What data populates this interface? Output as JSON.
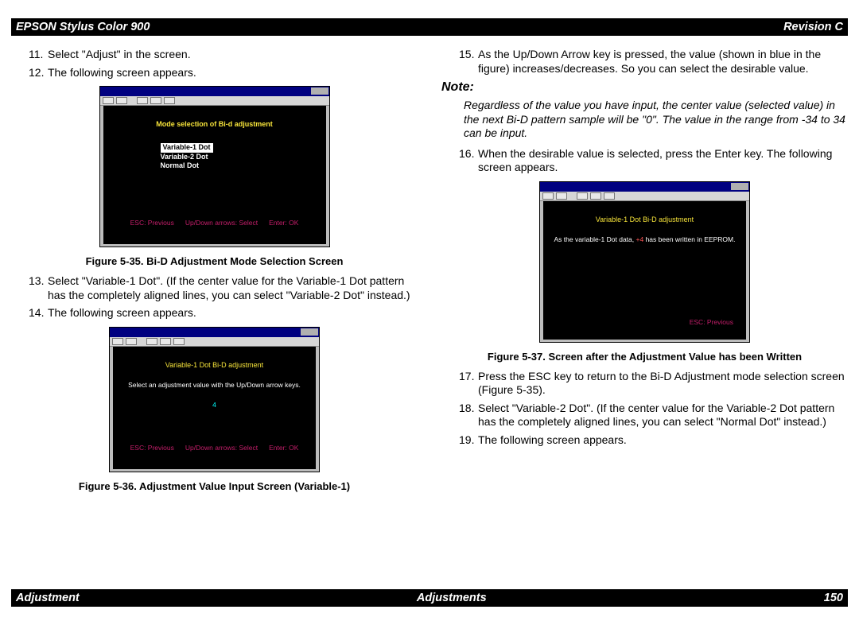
{
  "header": {
    "left": "EPSON Stylus Color 900",
    "right": "Revision C"
  },
  "footer": {
    "left": "Adjustment",
    "center": "Adjustments",
    "right": "150"
  },
  "left": {
    "step11": {
      "num": "11.",
      "text": "Select \"Adjust\" in the screen."
    },
    "step12": {
      "num": "12.",
      "text": "The following screen appears."
    },
    "fig35": {
      "caption": "Figure 5-35.  Bi-D Adjustment Mode Selection Screen",
      "title": "Mode selection of Bi-d adjustment",
      "opt1": "Variable-1 Dot",
      "opt2": "Variable-2 Dot",
      "opt3": "Normal Dot",
      "esc": "ESC: Previous",
      "arrows": "Up/Down arrows: Select",
      "enter": "Enter: OK"
    },
    "step13": {
      "num": "13.",
      "text": "Select \"Variable-1 Dot\". (If the center value for the Variable-1 Dot pattern has the completely aligned lines, you can select \"Variable-2 Dot\" instead.)"
    },
    "step14": {
      "num": "14.",
      "text": "The following screen appears."
    },
    "fig36": {
      "caption": "Figure 5-36.  Adjustment Value Input Screen (Variable-1)",
      "title": "Variable-1 Dot Bi-D adjustment",
      "instr": "Select an adjustment value with the Up/Down arrow keys.",
      "value": "4",
      "esc": "ESC: Previous",
      "arrows": "Up/Down arrows: Select",
      "enter": "Enter: OK"
    }
  },
  "right": {
    "step15": {
      "num": "15.",
      "text": "As the Up/Down Arrow key is pressed, the value (shown in blue in the figure) increases/decreases. So you can select the desirable value."
    },
    "note": {
      "label": "Note:",
      "body": "Regardless of the value you have input, the center value (selected value) in the next Bi-D pattern sample will be \"0\". The value in the range from -34 to 34 can be input."
    },
    "step16": {
      "num": "16.",
      "text": "When the desirable value is selected, press the Enter key. The following screen appears."
    },
    "fig37": {
      "caption": "Figure 5-37.  Screen after the Adjustment Value has been Written",
      "title": "Variable-1 Dot Bi-D adjustment",
      "line_pre": "As the variable-1 Dot data,",
      "line_val": "+4",
      "line_post": " has been written in EEPROM.",
      "esc": "ESC: Previous"
    },
    "step17": {
      "num": "17.",
      "text": "Press the ESC key to return to the Bi-D Adjustment mode selection screen (Figure 5-35)."
    },
    "step18": {
      "num": "18.",
      "text": "Select \"Variable-2 Dot\". (If the center value for the Variable-2 Dot pattern has the completely aligned lines, you can select \"Normal Dot\" instead.)"
    },
    "step19": {
      "num": "19.",
      "text": "The following screen appears."
    }
  }
}
